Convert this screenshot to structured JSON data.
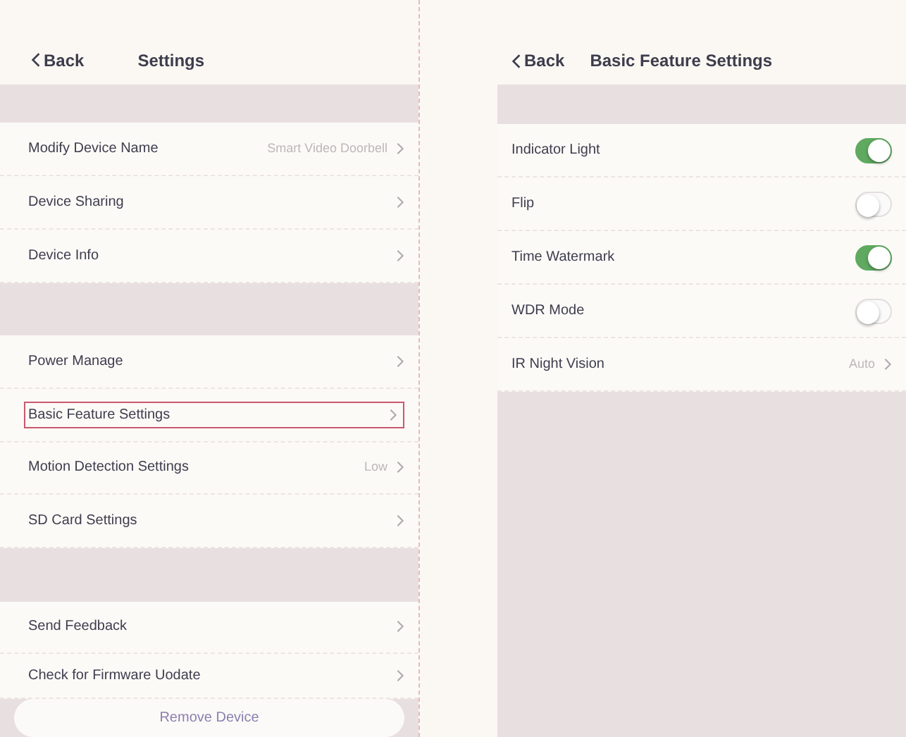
{
  "screens": [
    {
      "back_label": "Back",
      "title": "Settings",
      "groups": [
        [
          {
            "label": "Modify Device Name",
            "value": "Smart Video Doorbell",
            "highlighted": false
          },
          {
            "label": "Device Sharing",
            "highlighted": false
          },
          {
            "label": "Device Info",
            "highlighted": false
          }
        ],
        [
          {
            "label": "Power Manage",
            "highlighted": false
          },
          {
            "label": "Basic Feature Settings",
            "highlighted": true
          },
          {
            "label": "Motion Detection Settings",
            "value": "Low",
            "highlighted": false
          },
          {
            "label": "SD Card Settings",
            "highlighted": false
          }
        ],
        [
          {
            "label": "Send Feedback",
            "highlighted": false
          },
          {
            "label": "Check for Firmware Uodate",
            "highlighted": false
          }
        ]
      ],
      "footer_button": "Remove Device"
    },
    {
      "back_label": "Back",
      "title": "Basic Feature Settings",
      "groups": [
        [
          {
            "kind": "toggle",
            "label": "Indicator Light",
            "on": true
          },
          {
            "kind": "toggle",
            "label": "Flip",
            "on": false
          },
          {
            "kind": "toggle",
            "label": "Time Watermark",
            "on": true
          },
          {
            "kind": "toggle",
            "label": "WDR Mode",
            "on": false
          },
          {
            "kind": "link",
            "label": "IR Night Vision",
            "value": "Auto"
          }
        ]
      ]
    }
  ]
}
